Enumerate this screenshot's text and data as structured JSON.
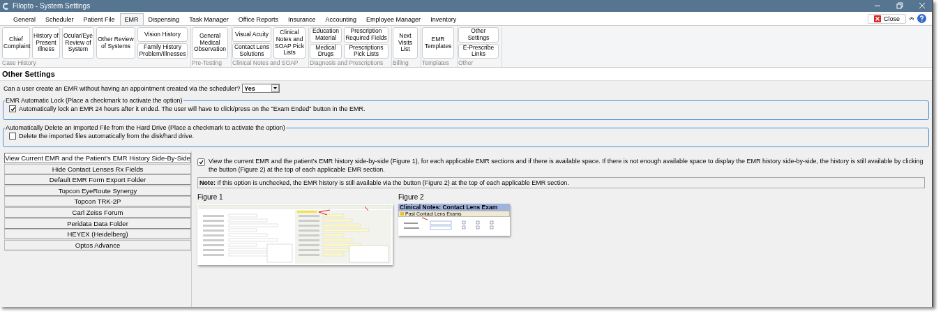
{
  "window": {
    "title": "Filopto - System Settings"
  },
  "tabs": [
    {
      "label": "General",
      "selected": false
    },
    {
      "label": "Scheduler",
      "selected": false
    },
    {
      "label": "Patient File",
      "selected": false
    },
    {
      "label": "EMR",
      "selected": true
    },
    {
      "label": "Dispensing",
      "selected": false
    },
    {
      "label": "Task Manager",
      "selected": false
    },
    {
      "label": "Office Reports",
      "selected": false
    },
    {
      "label": "Insurance",
      "selected": false
    },
    {
      "label": "Accounting",
      "selected": false
    },
    {
      "label": "Employee Manager",
      "selected": false
    },
    {
      "label": "Inventory",
      "selected": false
    }
  ],
  "close_button": "Close",
  "ribbon": {
    "groups": [
      {
        "label": "Case History",
        "columns": [
          [
            "Chief Complaint"
          ],
          [
            "History of Present Illness"
          ],
          [
            "Ocular/Eye Review of System"
          ],
          [
            "Other Review of Systems"
          ],
          [
            "Vision History",
            "Family History Problem/Illnesses"
          ]
        ]
      },
      {
        "label": "Pre-Testing",
        "columns": [
          [
            "General Medical Observation"
          ]
        ]
      },
      {
        "label": "Clinical Notes and SOAP",
        "columns": [
          [
            "Visual Acuity",
            "Contact Lens Solutions"
          ],
          [
            "Clinical Notes and SOAP Pick Lists"
          ]
        ]
      },
      {
        "label": "Diagnosis and Prescriptions",
        "columns": [
          [
            "Education Material",
            "Medical Drugs"
          ],
          [
            "Prescription Required Fields",
            "Prescriptions Pick Lists"
          ]
        ]
      },
      {
        "label": "Billing",
        "columns": [
          [
            "Next Visits List"
          ]
        ]
      },
      {
        "label": "Templates",
        "columns": [
          [
            "EMR Templates"
          ]
        ]
      },
      {
        "label": "Other",
        "columns": [
          [
            "Other Settings",
            "E-Prescribe Links"
          ]
        ]
      }
    ]
  },
  "section_title": "Other Settings",
  "question": {
    "label": "Can a user create an EMR without having an appointment created via the scheduler?",
    "value": "Yes"
  },
  "option_groups": [
    {
      "legend": "EMR Automatic Lock (Place a checkmark to activate the option)",
      "option": {
        "label": "Automatically lock an EMR 24 hours after it ended.  The user will have to click/press on the \"Exam Ended\" button in the EMR.",
        "checked": true
      }
    },
    {
      "legend": "Automatically Delete an Imported File from the Hard Drive (Place a checkmark to activate the option)",
      "option": {
        "label": "Delete the imported files automatically from the disk/hard drive.",
        "checked": false
      }
    }
  ],
  "side_buttons": [
    {
      "label": "View Current EMR and the Patient's EMR History Side-By-Side",
      "selected": true
    },
    {
      "label": "Hide Contact Lenses Rx Fields",
      "selected": false
    },
    {
      "label": "Default EMR Form Export Folder",
      "selected": false
    },
    {
      "label": "Topcon EyeRoute Synergy",
      "selected": false
    },
    {
      "label": "Topcon TRK-2P",
      "selected": false
    },
    {
      "label": "Carl Zeiss Forum",
      "selected": false
    },
    {
      "label": "Peridata Data Folder",
      "selected": false
    },
    {
      "label": "HEYEX (Heidelberg)",
      "selected": false
    },
    {
      "label": "Optos Advance",
      "selected": false
    }
  ],
  "detail": {
    "option": {
      "label": "View the current EMR and the patient's EMR history side-by-side (Figure 1), for each applicable EMR sections and if there is available space.  If there is not enough available space to display the EMR history side-by-side, the history is still available by clicking the button (Figure 2) at the top of each applicable EMR section.",
      "checked": true
    },
    "note": "**Note:** If this option is unchecked, the EMR history is still available via the button (Figure 2) at the top of each applicable EMR section.",
    "figures": [
      {
        "caption": "Figure 1",
        "kind": "form"
      },
      {
        "caption": "Figure 2",
        "kind": "panel",
        "header": "Clinical Notes:  Contact Lens Exam",
        "button": "Past Contact Lens Exams"
      }
    ]
  }
}
